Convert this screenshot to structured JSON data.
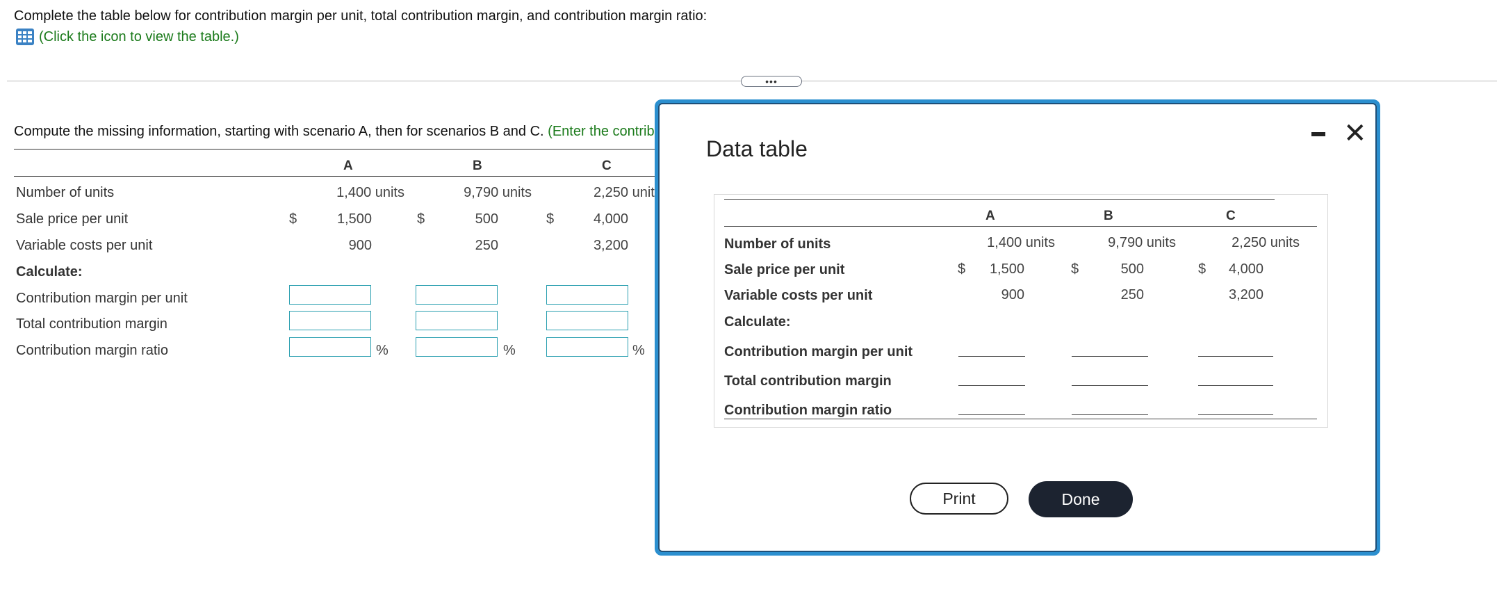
{
  "question": {
    "prompt": "Complete the table below for contribution margin per unit, total contribution margin, and contribution margin ratio:",
    "icon_hint": "(Click the icon to view the table.)"
  },
  "handle_label": "•••",
  "instructions": {
    "text": "Compute the missing information, starting with scenario A, then for scenarios B and C. ",
    "hint": "(Enter the contributi"
  },
  "main_table": {
    "columns": [
      "A",
      "B",
      "C"
    ],
    "rows": {
      "units": {
        "label": "Number of units",
        "a": "1,400 units",
        "b": "9,790 units",
        "c": "2,250 unit"
      },
      "price": {
        "label": "Sale price per unit",
        "dollar": "$",
        "a": "1,500",
        "b": "500",
        "c": "4,000"
      },
      "variable": {
        "label": "Variable costs per unit",
        "a": "900",
        "b": "250",
        "c": "3,200"
      },
      "calc": {
        "label": "Calculate:"
      },
      "cm_unit": {
        "label": "Contribution margin per unit"
      },
      "total_cm": {
        "label": "Total contribution margin"
      },
      "cm_ratio": {
        "label": "Contribution margin ratio",
        "pct": "%"
      }
    }
  },
  "modal": {
    "title": "Data table",
    "columns": [
      "A",
      "B",
      "C"
    ],
    "rows": {
      "units": {
        "label": "Number of units",
        "a": "1,400 units",
        "b": "9,790 units",
        "c": "2,250 units"
      },
      "price": {
        "label": "Sale price per unit",
        "dollar": "$",
        "a": "1,500",
        "b": "500",
        "c": "4,000"
      },
      "variable": {
        "label": "Variable costs per unit",
        "a": "900",
        "b": "250",
        "c": "3,200"
      },
      "calc": {
        "label": "Calculate:"
      },
      "cm_unit": {
        "label": "Contribution margin per unit"
      },
      "total_cm": {
        "label": "Total contribution margin"
      },
      "cm_ratio": {
        "label": "Contribution margin ratio"
      }
    },
    "buttons": {
      "print": "Print",
      "done": "Done"
    }
  }
}
